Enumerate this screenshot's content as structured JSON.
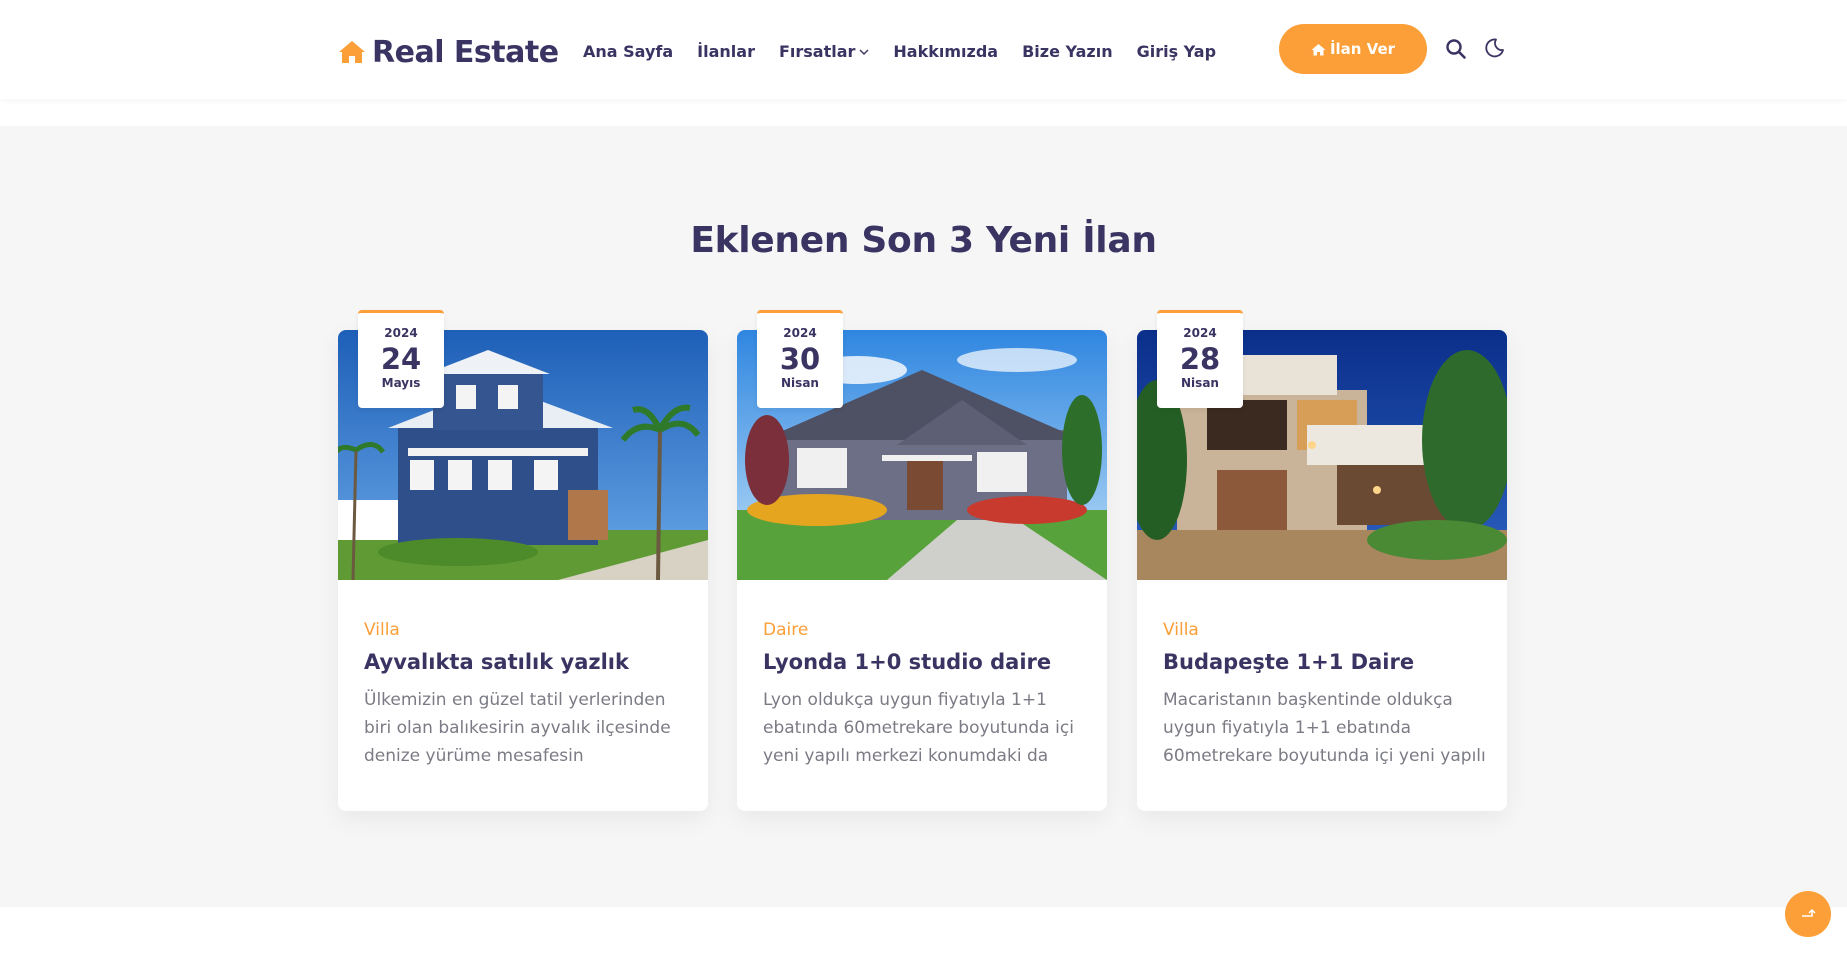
{
  "brand": {
    "name": "Real Estate",
    "accent_color": "#fc9f38",
    "text_color": "#3a3463"
  },
  "nav": {
    "items": [
      {
        "label": "Ana Sayfa"
      },
      {
        "label": "İlanlar"
      },
      {
        "label": "Fırsatlar",
        "has_dropdown": true
      },
      {
        "label": "Hakkımızda"
      },
      {
        "label": "Bize Yazın"
      },
      {
        "label": "Giriş Yap"
      }
    ],
    "cta_label": "İlan Ver",
    "cta_icon": "house-icon",
    "search_icon": "search-icon",
    "theme_icon": "moon-icon"
  },
  "section": {
    "title": "Eklenen Son 3 Yeni İlan"
  },
  "listings": [
    {
      "year": "2024",
      "day": "24",
      "month": "Mayıs",
      "category": "Villa",
      "title": "Ayvalıkta satılık yazlık",
      "description": "Ülkemizin en güzel tatil yerlerinden biri olan balıkesirin ayvalık ilçesinde denize yürüme mesafesin"
    },
    {
      "year": "2024",
      "day": "30",
      "month": "Nisan",
      "category": "Daire",
      "title": "Lyonda 1+0 studio daire",
      "description": "Lyon oldukça uygun fiyatıyla 1+1 ebatında 60metrekare boyutunda içi yeni yapılı merkezi konumdaki da"
    },
    {
      "year": "2024",
      "day": "28",
      "month": "Nisan",
      "category": "Villa",
      "title": "Budapeşte 1+1 Daire",
      "description": "Macaristanın başkentinde oldukça uygun fiyatıyla 1+1 ebatında 60metrekare boyutunda içi yeni yapılı"
    }
  ],
  "scroll_top_icon": "arrow-up-icon"
}
